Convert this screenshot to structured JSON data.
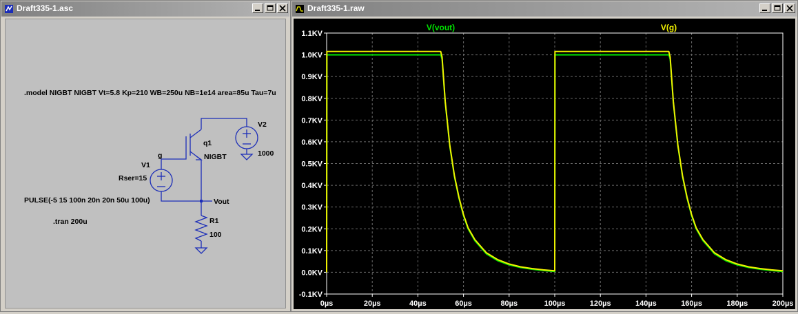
{
  "schematic_window": {
    "title": "Draft335-1.asc",
    "model_directive": ".model NIGBT NIGBT Vt=5.8 Kp=210  WB=250u NB=1e14 area=85u Tau=7u",
    "components": {
      "q1_name": "q1",
      "q1_model": "NIGBT",
      "v1_name": "V1",
      "v1_rser": "Rser=15",
      "v1_value": "PULSE(-5 15 100n 20n 20n 50u 100u)",
      "v2_name": "V2",
      "v2_value": "1000",
      "r1_name": "R1",
      "r1_value": "100",
      "net_g": "g",
      "net_vout": "Vout"
    },
    "tran_directive": ".tran 200u"
  },
  "plot_window": {
    "title": "Draft335-1.raw"
  },
  "colors": {
    "trace_vout": "#00e000",
    "trace_g": "#f0f000",
    "plot_bg": "#000000",
    "schematic_wire": "#1b2db8"
  },
  "chart_data": {
    "type": "line",
    "x_unit": "µs",
    "y_unit": "KV",
    "xlim": [
      0,
      200
    ],
    "ylim": [
      -0.1,
      1.1
    ],
    "x_ticks": [
      "0µs",
      "20µs",
      "40µs",
      "60µs",
      "80µs",
      "100µs",
      "120µs",
      "140µs",
      "160µs",
      "180µs",
      "200µs"
    ],
    "y_ticks": [
      "1.1KV",
      "1.0KV",
      "0.9KV",
      "0.8KV",
      "0.7KV",
      "0.6KV",
      "0.5KV",
      "0.4KV",
      "0.3KV",
      "0.2KV",
      "0.1KV",
      "0.0KV",
      "-0.1KV"
    ],
    "y_tick_values": [
      1.1,
      1.0,
      0.9,
      0.8,
      0.7,
      0.6,
      0.5,
      0.4,
      0.3,
      0.2,
      0.1,
      0.0,
      -0.1
    ],
    "x_tick_values": [
      0,
      20,
      40,
      60,
      80,
      100,
      120,
      140,
      160,
      180,
      200
    ],
    "grid": true,
    "series": [
      {
        "name": "V(vout)",
        "color": "#00e000",
        "x": [
          0,
          0.1,
          50,
          50.6,
          52,
          54,
          56,
          58,
          60,
          62,
          65,
          70,
          75,
          80,
          85,
          90,
          95,
          99.9,
          100,
          100.1,
          150,
          150.6,
          152,
          154,
          156,
          158,
          160,
          162,
          165,
          170,
          175,
          180,
          185,
          190,
          195,
          200
        ],
        "y": [
          0,
          1.0,
          1.0,
          0.98,
          0.78,
          0.58,
          0.44,
          0.34,
          0.26,
          0.2,
          0.145,
          0.085,
          0.053,
          0.034,
          0.022,
          0.014,
          0.008,
          0.004,
          0.004,
          1.0,
          1.0,
          0.98,
          0.78,
          0.58,
          0.44,
          0.34,
          0.26,
          0.2,
          0.145,
          0.085,
          0.053,
          0.034,
          0.022,
          0.014,
          0.008,
          0.004
        ]
      },
      {
        "name": "V(g)",
        "color": "#f0f000",
        "x": [
          0,
          0.1,
          50,
          50.6,
          52,
          54,
          56,
          58,
          60,
          62,
          65,
          70,
          75,
          80,
          85,
          90,
          95,
          99.9,
          100,
          100.1,
          150,
          150.6,
          152,
          154,
          156,
          158,
          160,
          162,
          165,
          170,
          175,
          180,
          185,
          190,
          195,
          200
        ],
        "y": [
          0,
          1.015,
          1.015,
          0.99,
          0.785,
          0.585,
          0.445,
          0.345,
          0.265,
          0.205,
          0.15,
          0.09,
          0.058,
          0.038,
          0.025,
          0.017,
          0.011,
          0.007,
          0.007,
          1.015,
          1.015,
          0.99,
          0.785,
          0.585,
          0.445,
          0.345,
          0.265,
          0.205,
          0.15,
          0.09,
          0.058,
          0.038,
          0.025,
          0.017,
          0.011,
          0.007
        ]
      }
    ]
  }
}
